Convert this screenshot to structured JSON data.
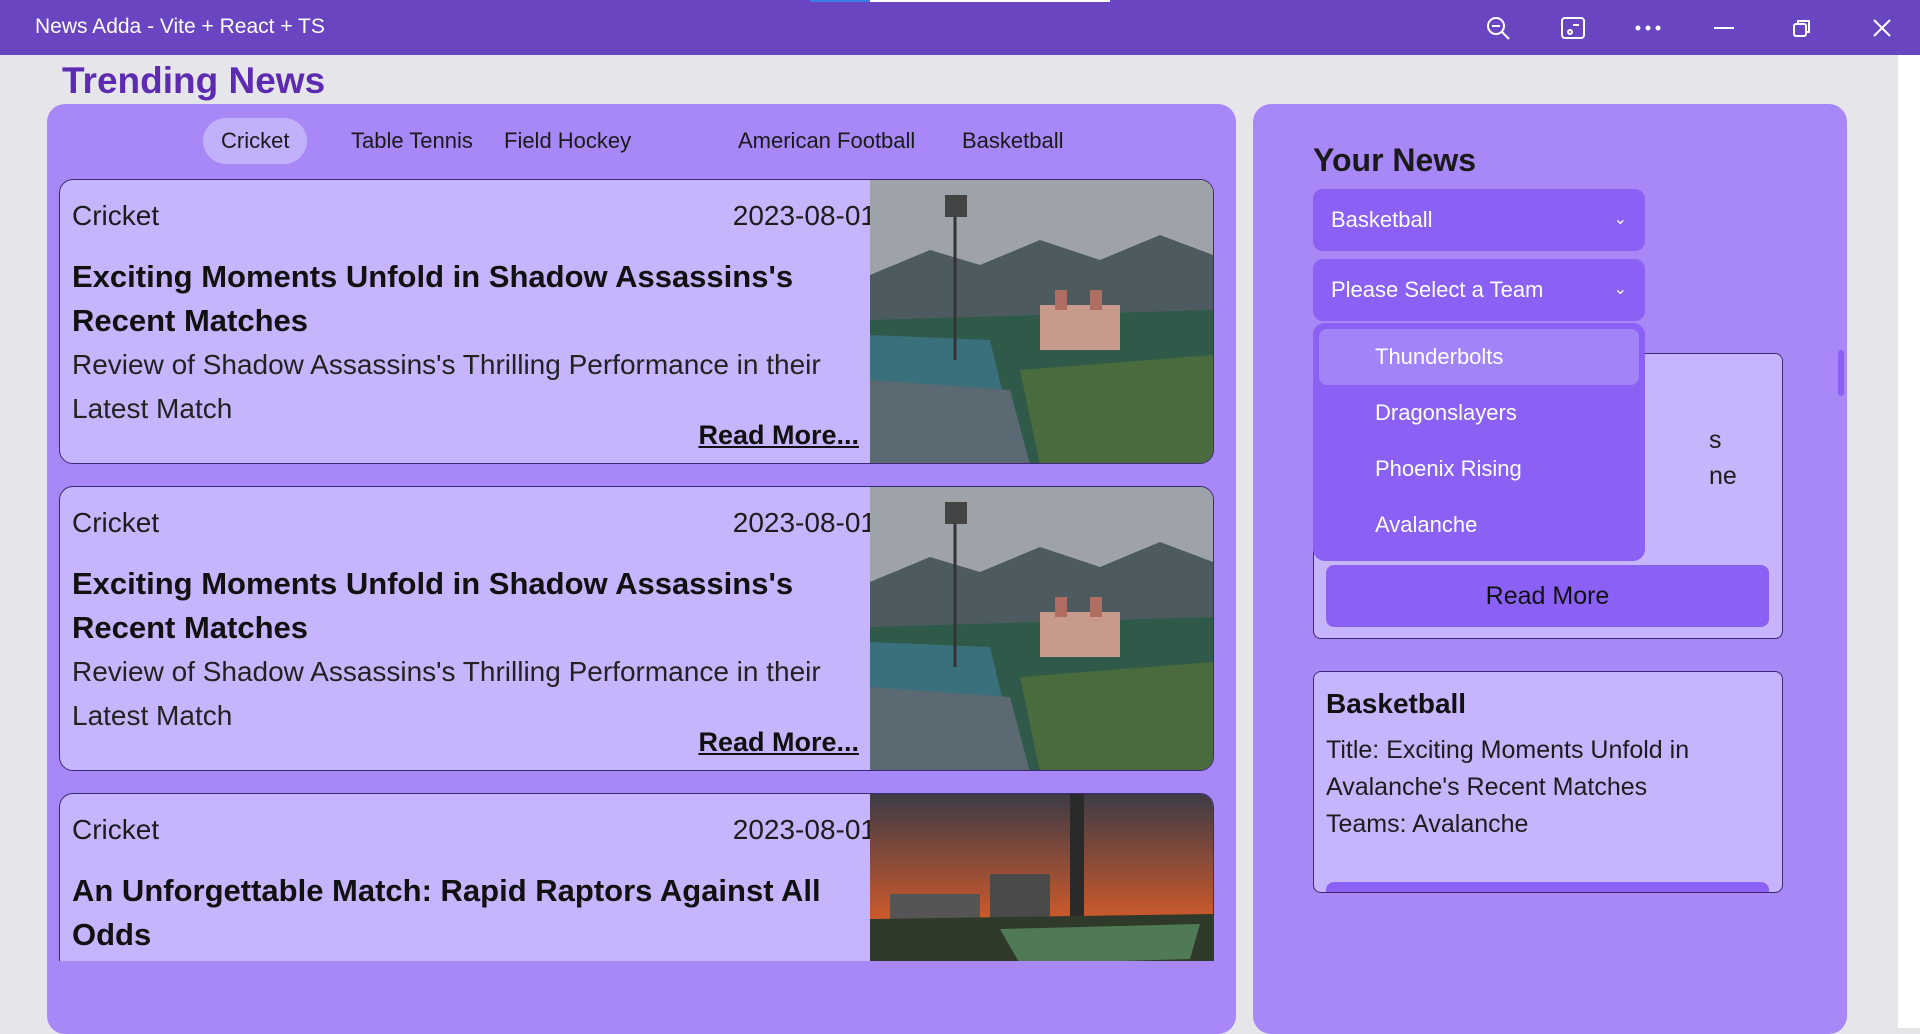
{
  "window": {
    "title": "News Adda - Vite + React + TS",
    "controls": [
      "zoom-icon",
      "cast-icon",
      "more-icon",
      "minimize-icon",
      "restore-icon",
      "close-icon"
    ]
  },
  "page": {
    "heading": "Trending News"
  },
  "tabs": [
    {
      "label": "Cricket",
      "active": true
    },
    {
      "label": "Table Tennis"
    },
    {
      "label": "Field Hockey"
    },
    {
      "label": "American Football"
    },
    {
      "label": "Basketball"
    }
  ],
  "news": [
    {
      "category": "Cricket",
      "date": "2023-08-01",
      "headline": "Exciting Moments Unfold in Shadow Assassins's Recent Matches",
      "description": "Review of Shadow Assassins's Thrilling Performance in their Latest Match",
      "read_more": "Read More..."
    },
    {
      "category": "Cricket",
      "date": "2023-08-01",
      "headline": "Exciting Moments Unfold in Shadow Assassins's Recent Matches",
      "description": "Review of Shadow Assassins's Thrilling Performance in their Latest Match",
      "read_more": "Read More..."
    },
    {
      "category": "Cricket",
      "date": "2023-08-01",
      "headline": "An Unforgettable Match: Rapid Raptors Against All Odds",
      "description": "",
      "read_more": ""
    }
  ],
  "your_news": {
    "title": "Your News",
    "sport_select": "Basketball",
    "team_select_placeholder": "Please Select a Team",
    "team_options": [
      "Thunderbolts",
      "Dragonslayers",
      "Phoenix Rising",
      "Avalanche"
    ],
    "hidden_card": {
      "partial1": "s",
      "partial2": "ne",
      "button": "Read More"
    },
    "card": {
      "sport": "Basketball",
      "title_line": "Title: Exciting Moments Unfold in Avalanche's Recent Matches",
      "teams_line": "Teams: Avalanche"
    }
  },
  "colors": {
    "titlebar": "#6a45c2",
    "panel": "#a887f7",
    "card": "#c6b5fc",
    "accent": "#8a60f5",
    "heading": "#5d2bb1"
  }
}
